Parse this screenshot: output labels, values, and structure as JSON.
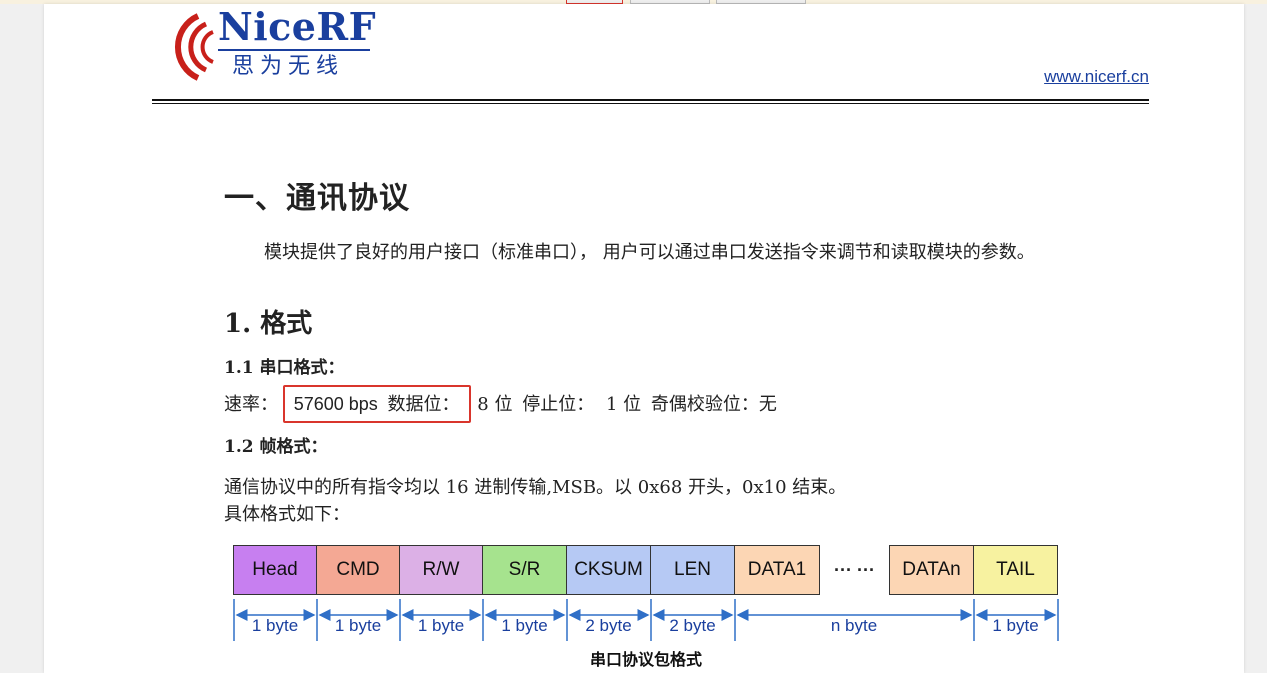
{
  "header": {
    "logo_name": "NiceRF",
    "logo_cn": "思为无线",
    "website": "www.nicerf.cn"
  },
  "section": {
    "title": "一、通讯协议",
    "intro": "模块提供了良好的用户接口（标准串口）， 用户可以通过串口发送指令来调节和读取模块的参数。"
  },
  "format": {
    "heading": "1. 格式",
    "serial_heading": "1.1 串口格式：",
    "rate_label": "速率：",
    "rate_value": "57600 bps",
    "databits_label": "数据位：",
    "databits_value": "8 位",
    "stopbits_label": "停止位：",
    "stopbits_value": "1 位",
    "parity_label": "奇偶校验位：",
    "parity_value": "无",
    "frame_heading": "1.2 帧格式：",
    "frame_desc_1": "通信协议中的所有指令均以 16 进制传输,MSB。以 0x68 开头，0x10 结束。",
    "frame_desc_2": "具体格式如下："
  },
  "frame_diagram": {
    "fields": [
      {
        "name": "Head",
        "color": "#c77ff0",
        "size": "1 byte"
      },
      {
        "name": "CMD",
        "color": "#f4a894",
        "size": "1 byte"
      },
      {
        "name": "R/W",
        "color": "#dcb0e6",
        "size": "1 byte"
      },
      {
        "name": "S/R",
        "color": "#a6e38e",
        "size": "1 byte"
      },
      {
        "name": "CKSUM",
        "color": "#b6c9f4",
        "size": "2 byte"
      },
      {
        "name": "LEN",
        "color": "#b6c9f4",
        "size": "2 byte"
      },
      {
        "name": "DATA1",
        "color": "#fcd6b4",
        "size": "n byte"
      },
      {
        "name": "···  ···",
        "color": "#ffffff",
        "size": ""
      },
      {
        "name": "DATAn",
        "color": "#fcd6b4",
        "size": ""
      },
      {
        "name": "TAIL",
        "color": "#f7f2a0",
        "size": "1 byte"
      }
    ],
    "caption": "串口协议包格式"
  }
}
